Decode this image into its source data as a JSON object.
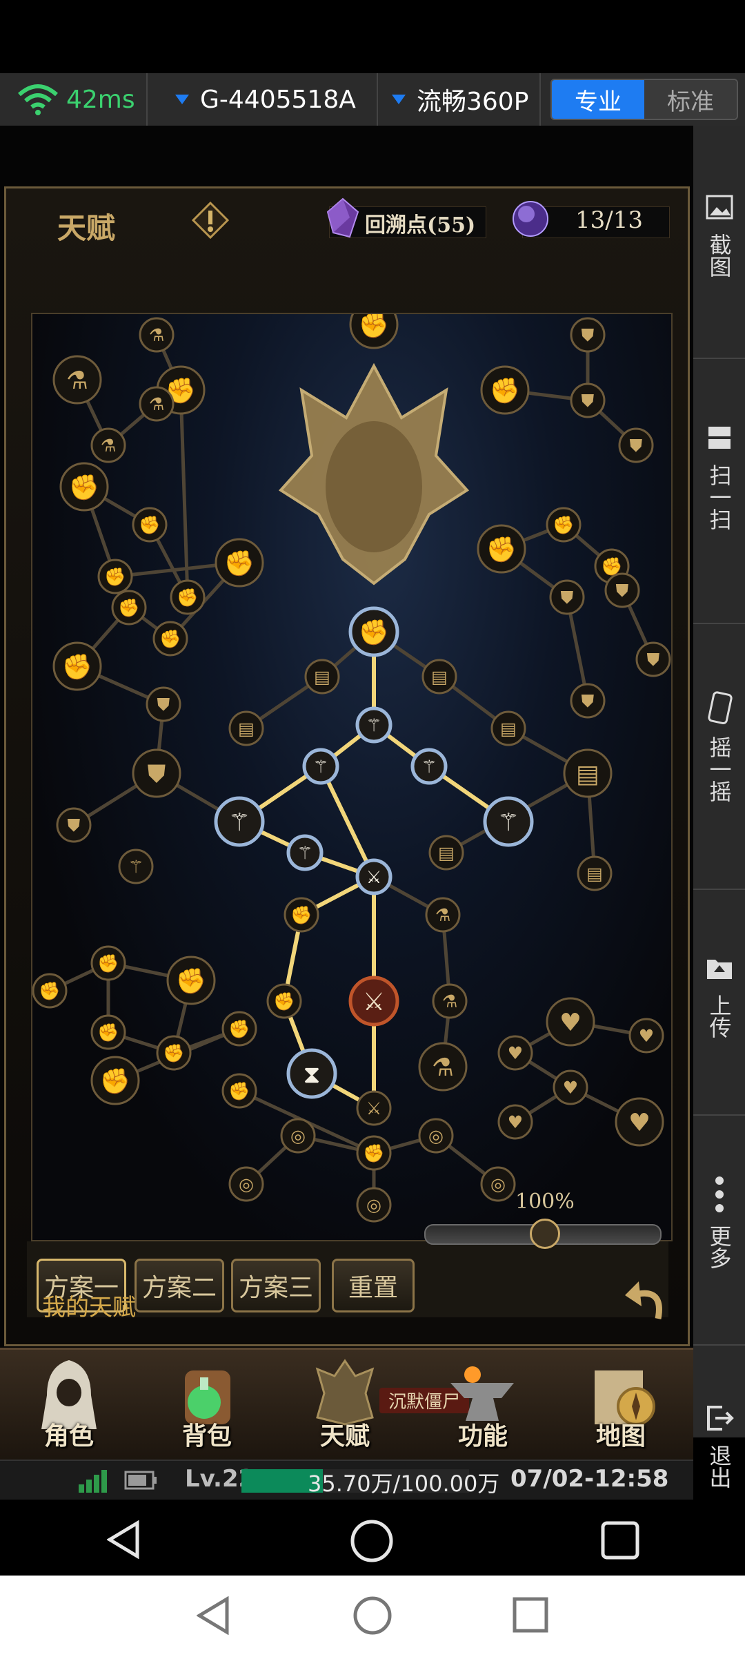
{
  "topbar": {
    "ping": "42ms",
    "device_id": "G-4405518A",
    "quality": "流畅360P",
    "mode_pro": "专业",
    "mode_standard": "标准"
  },
  "sidebar": {
    "items": [
      {
        "label": "截图",
        "icon": "screenshot-icon"
      },
      {
        "label": "扫一扫",
        "icon": "scan-icon"
      },
      {
        "label": "摇一摇",
        "icon": "shake-icon"
      },
      {
        "label": "上传",
        "icon": "upload-icon"
      },
      {
        "label": "更多",
        "icon": "more-icon"
      },
      {
        "label": "退出",
        "icon": "exit-icon"
      }
    ]
  },
  "talent": {
    "title": "天赋",
    "points_label": "回溯点(55)",
    "counter": "13/13",
    "zoom": "100%",
    "zoom_value": 1.0,
    "my_talent": "我的天赋",
    "buttons": {
      "plan1": "方案一",
      "plan2": "方案二",
      "plan3": "方案三",
      "reset": "重置"
    }
  },
  "nav": {
    "items": [
      {
        "label": "角色",
        "icon": "hooded-character-icon"
      },
      {
        "label": "背包",
        "icon": "backpack-potion-icon"
      },
      {
        "label": "天赋",
        "icon": "dragon-talent-icon"
      },
      {
        "label": "功能",
        "icon": "anvil-icon"
      },
      {
        "label": "地图",
        "icon": "map-compass-icon"
      }
    ],
    "overlay_text": "沉默僵尸"
  },
  "status": {
    "level": "Lv.22",
    "exp": "35.70万/100.00万",
    "exp_fraction": 0.357,
    "datetime": "07/02-12:58"
  },
  "colors": {
    "accent_blue": "#1e7cf2",
    "ping_green": "#3bd16f",
    "gold": "#c9a867",
    "exp_green": "#0c8a5a"
  }
}
